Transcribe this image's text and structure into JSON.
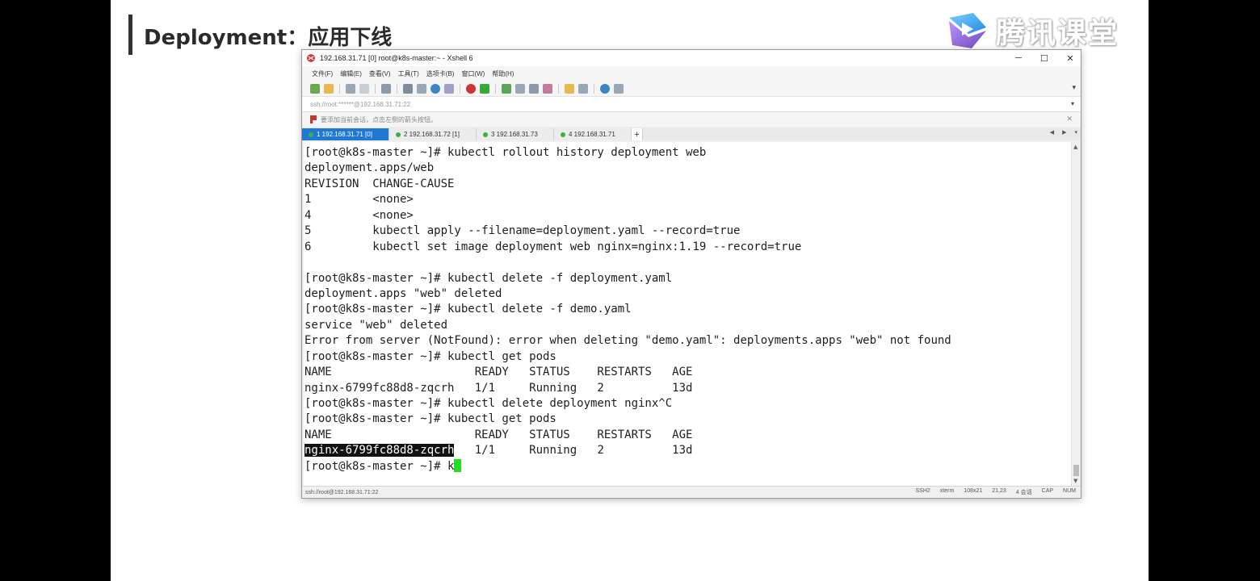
{
  "slide": {
    "title": "Deployment：应用下线",
    "logo_text": "腾讯课堂"
  },
  "window": {
    "title": "192.168.31.71 [0]    root@k8s-master:~  - Xshell 6",
    "controls": [
      "─",
      "☐",
      "✕"
    ],
    "menu": [
      "文件(F)",
      "编辑(E)",
      "查看(V)",
      "工具(T)",
      "选项卡(B)",
      "窗口(W)",
      "帮助(H)"
    ],
    "address": "ssh://root:******@192.168.31.71:22",
    "info": "要添加当前会话，点击左侧的箭头按钮。",
    "tabs": [
      {
        "label": "1 192.168.31.71 [0]",
        "active": true
      },
      {
        "label": "2 192.168.31.72 [1]",
        "active": false
      },
      {
        "label": "3 192.168.31.73",
        "active": false
      },
      {
        "label": "4 192.168.31.71",
        "active": false
      }
    ],
    "tab_add": "+",
    "status_left": "ssh://root@192.168.31.71:22",
    "status_right": [
      "SSH2",
      "xterm",
      "108x21",
      "21,23",
      "4 会话",
      "CAP",
      "NUM"
    ]
  },
  "terminal": {
    "lines": [
      "[root@k8s-master ~]# kubectl rollout history deployment web",
      "deployment.apps/web",
      "REVISION  CHANGE-CAUSE",
      "1         <none>",
      "4         <none>",
      "5         kubectl apply --filename=deployment.yaml --record=true",
      "6         kubectl set image deployment web nginx=nginx:1.19 --record=true",
      "",
      "[root@k8s-master ~]# kubectl delete -f deployment.yaml",
      "deployment.apps \"web\" deleted",
      "[root@k8s-master ~]# kubectl delete -f demo.yaml",
      "service \"web\" deleted",
      "Error from server (NotFound): error when deleting \"demo.yaml\": deployments.apps \"web\" not found",
      "[root@k8s-master ~]# kubectl get pods",
      "NAME                     READY   STATUS    RESTARTS   AGE",
      "nginx-6799fc88d8-zqcrh   1/1     Running   2          13d",
      "[root@k8s-master ~]# kubectl delete deployment nginx^C",
      "[root@k8s-master ~]# kubectl get pods",
      "NAME                     READY   STATUS    RESTARTS   AGE"
    ],
    "highlight_name": "nginx-6799fc88d8-zqcrh",
    "highlight_rest": "   1/1     Running   2          13d",
    "prompt_line": "[root@k8s-master ~]# k"
  },
  "colors": {
    "tab_active": "#1f78d1",
    "cursor": "#22dd22",
    "session_dot": "#3cb043"
  }
}
